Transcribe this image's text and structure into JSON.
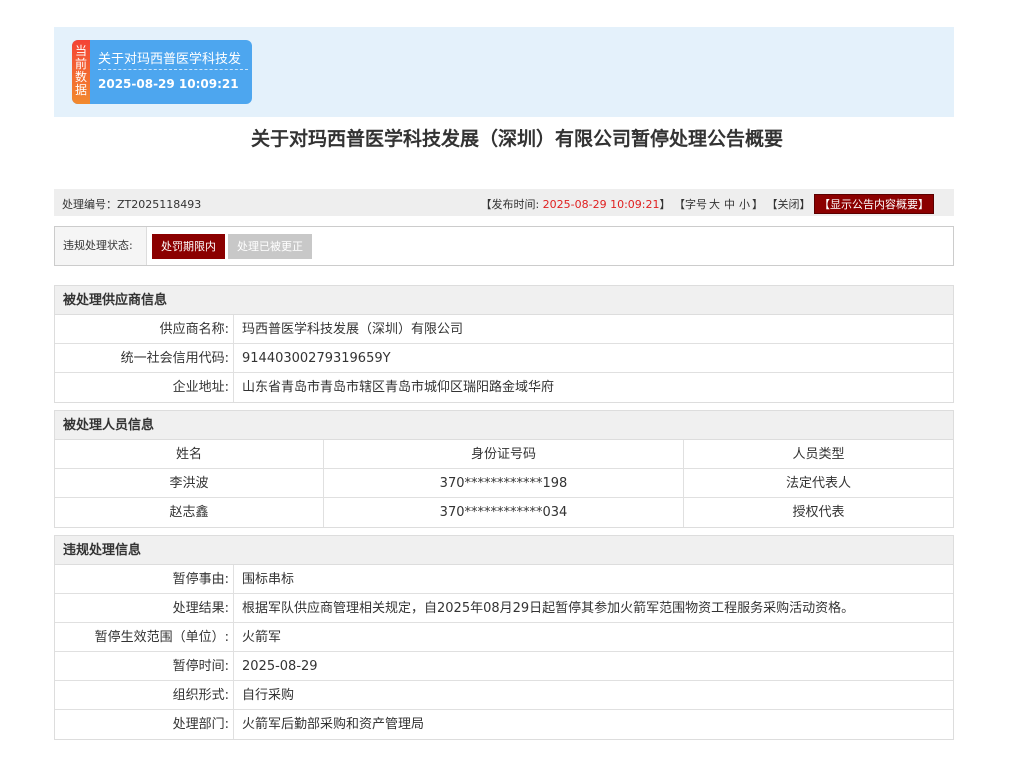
{
  "banner": {
    "tag": "当前数据",
    "card_title": "关于对玛西普医学科技发",
    "card_time": "2025-08-29 10:09:21"
  },
  "title": "关于对玛西普医学科技发展（深圳）有限公司暂停处理公告概要",
  "meta": {
    "code_label": "处理编号：",
    "code_value": "ZT2025118493",
    "publish_prefix": "【发布时间: ",
    "publish_time": "2025-08-29 10:09:21",
    "publish_suffix": "】",
    "font_prefix": "【字号",
    "font_large": "大",
    "font_medium": "中",
    "font_small": "小",
    "font_suffix": "】",
    "close": "【关闭】",
    "show_summary": "【显示公告内容概要】"
  },
  "status": {
    "label": "违规处理状态:",
    "active": "处罚期限内",
    "inactive": "处理已被更正"
  },
  "supplier": {
    "heading": "被处理供应商信息",
    "rows": [
      {
        "k": "供应商名称:",
        "v": "玛西普医学科技发展（深圳）有限公司"
      },
      {
        "k": "统一社会信用代码:",
        "v": "91440300279319659Y"
      },
      {
        "k": "企业地址:",
        "v": "山东省青岛市青岛市辖区青岛市城仰区瑞阳路金域华府"
      }
    ]
  },
  "persons": {
    "heading": "被处理人员信息",
    "columns": [
      "姓名",
      "身份证号码",
      "人员类型"
    ],
    "rows": [
      [
        "李洪波",
        "370************198",
        "法定代表人"
      ],
      [
        "赵志鑫",
        "370************034",
        "授权代表"
      ]
    ]
  },
  "violation": {
    "heading": "违规处理信息",
    "rows": [
      {
        "k": "暂停事由:",
        "v": "围标串标"
      },
      {
        "k": "处理结果:",
        "v": "根据军队供应商管理相关规定，自2025年08月29日起暂停其参加火箭军范围物资工程服务采购活动资格。"
      },
      {
        "k": "暂停生效范围（单位）:",
        "v": "火箭军"
      },
      {
        "k": "暂停时间:",
        "v": "2025-08-29"
      },
      {
        "k": "组织形式:",
        "v": "自行采购"
      },
      {
        "k": "处理部门:",
        "v": "火箭军后勤部采购和资产管理局"
      }
    ]
  },
  "colors": {
    "banner_bg": "#e4f1fb",
    "card_bg": "#4da6ef",
    "accent_dark_red": "#8b0000",
    "time_red": "#e02020"
  }
}
